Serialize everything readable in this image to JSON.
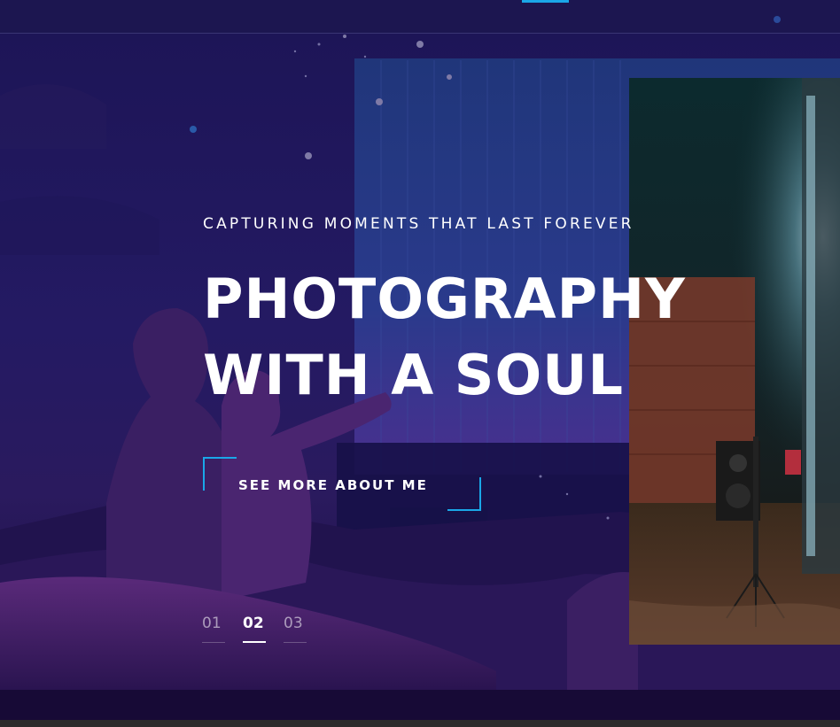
{
  "hero": {
    "eyebrow": "CAPTURING MOMENTS THAT LAST FOREVER",
    "headline_line1": "PHOTOGRAPHY",
    "headline_line2": "WITH A SOUL",
    "cta_label": "SEE MORE ABOUT ME"
  },
  "pager": {
    "items": [
      "01",
      "02",
      "03"
    ],
    "active_index": 1
  },
  "colors": {
    "accent": "#1aa7e8",
    "background": "#1d1557",
    "text": "#ffffff"
  }
}
